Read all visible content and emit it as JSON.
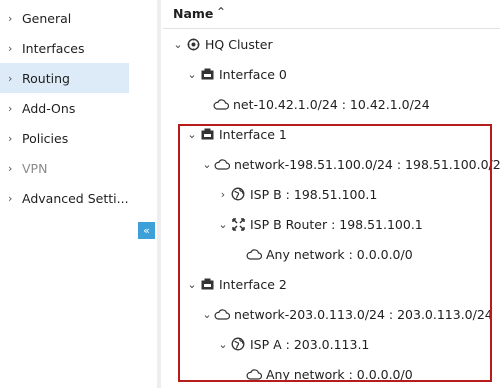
{
  "sidebar": {
    "items": [
      {
        "label": "General"
      },
      {
        "label": "Interfaces"
      },
      {
        "label": "Routing"
      },
      {
        "label": "Add-Ons"
      },
      {
        "label": "Policies"
      },
      {
        "label": "VPN"
      },
      {
        "label": "Advanced Setti..."
      }
    ],
    "active": "Routing",
    "collapse_glyph": "«"
  },
  "tree": {
    "header": "Name",
    "nodes": [
      {
        "label": "HQ Cluster",
        "icon": "cluster-icon",
        "expanded": true
      },
      {
        "label": "Interface 0",
        "icon": "interface-icon",
        "expanded": true
      },
      {
        "label": "net-10.42.1.0/24 : 10.42.1.0/24",
        "icon": "cloud-icon"
      },
      {
        "label": "Interface 1",
        "icon": "interface-icon",
        "expanded": true
      },
      {
        "label": "network-198.51.100.0/24 : 198.51.100.0/24",
        "icon": "cloud-icon",
        "expanded": true
      },
      {
        "label": "ISP B : 198.51.100.1",
        "icon": "globe-icon",
        "expanded": false
      },
      {
        "label": "ISP B Router : 198.51.100.1",
        "icon": "router-icon",
        "expanded": true
      },
      {
        "label": "Any network : 0.0.0.0/0",
        "icon": "cloud-icon"
      },
      {
        "label": "Interface 2",
        "icon": "interface-icon",
        "expanded": true
      },
      {
        "label": "network-203.0.113.0/24 : 203.0.113.0/24",
        "icon": "cloud-icon",
        "expanded": true
      },
      {
        "label": "ISP A : 203.0.113.1",
        "icon": "globe-icon",
        "expanded": true
      },
      {
        "label": "Any network : 0.0.0.0/0",
        "icon": "cloud-icon"
      }
    ]
  },
  "colors": {
    "active_bg": "#dcebf7",
    "collapse_button": "#3da0d8",
    "highlight_border": "#b71c1c"
  }
}
